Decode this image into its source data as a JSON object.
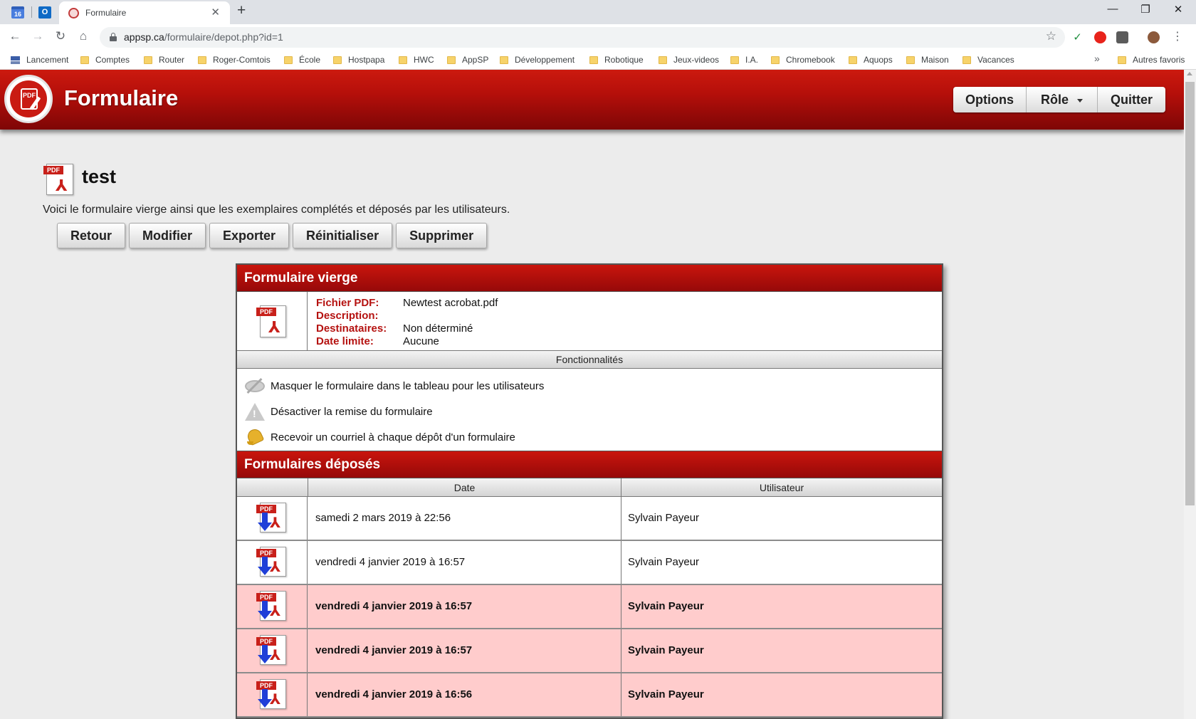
{
  "browser": {
    "pinned_tabs": [
      {
        "name": "calendar",
        "badge": "16"
      },
      {
        "name": "outlook",
        "badge": "O"
      }
    ],
    "active_tab": {
      "title": "Formulaire"
    },
    "url": {
      "host": "appsp.ca",
      "path": "/formulaire/depot.php?id=1"
    },
    "bookmarks": [
      {
        "label": "Lancement",
        "icon": "apps-icon"
      },
      {
        "label": "Comptes",
        "icon": "folder-icon"
      },
      {
        "label": "Router",
        "icon": "folder-icon"
      },
      {
        "label": "Roger-Comtois",
        "icon": "folder-icon"
      },
      {
        "label": "École",
        "icon": "folder-icon"
      },
      {
        "label": "Hostpapa",
        "icon": "folder-icon"
      },
      {
        "label": "HWC",
        "icon": "folder-icon"
      },
      {
        "label": "AppSP",
        "icon": "folder-icon"
      },
      {
        "label": "Développement",
        "icon": "folder-icon"
      },
      {
        "label": "Robotique",
        "icon": "folder-icon"
      },
      {
        "label": "Jeux-videos",
        "icon": "folder-icon"
      },
      {
        "label": "I.A.",
        "icon": "folder-icon"
      },
      {
        "label": "Chromebook",
        "icon": "folder-icon"
      },
      {
        "label": "Aquops",
        "icon": "folder-icon"
      },
      {
        "label": "Maison",
        "icon": "folder-icon"
      },
      {
        "label": "Vacances",
        "icon": "folder-icon"
      }
    ],
    "bookmarks_more": "»",
    "other_bookmarks": "Autres favoris"
  },
  "app": {
    "title": "Formulaire",
    "menu": {
      "options": "Options",
      "role": "Rôle",
      "quit": "Quitter"
    }
  },
  "form": {
    "name": "test",
    "intro": "Voici le formulaire vierge ainsi que les exemplaires complétés et déposés par les utilisateurs.",
    "actions": {
      "back": "Retour",
      "edit": "Modifier",
      "export": "Exporter",
      "reset": "Réinitialiser",
      "delete": "Supprimer"
    }
  },
  "blank_form": {
    "heading": "Formulaire vierge",
    "pdf_label": "PDF",
    "fields": {
      "file_label": "Fichier PDF:",
      "file_value": "Newtest acrobat.pdf",
      "desc_label": "Description:",
      "desc_value": "",
      "recip_label": "Destinataires:",
      "recip_value": "Non déterminé",
      "deadline_label": "Date limite:",
      "deadline_value": "Aucune"
    },
    "features_heading": "Fonctionnalités",
    "features": [
      {
        "label": "Masquer le formulaire dans le tableau pour les utilisateurs",
        "icon": "hidden-eye-icon"
      },
      {
        "label": "Désactiver la remise du formulaire",
        "icon": "warning-icon"
      },
      {
        "label": "Recevoir un courriel à chaque dépôt d'un formulaire",
        "icon": "bell-icon"
      }
    ]
  },
  "submissions": {
    "heading": "Formulaires déposés",
    "columns": {
      "date": "Date",
      "user": "Utilisateur"
    },
    "rows": [
      {
        "date": "samedi 2 mars 2019 à 22:56",
        "user": "Sylvain Payeur",
        "highlighted": false
      },
      {
        "date": "vendredi 4 janvier 2019 à 16:57",
        "user": "Sylvain Payeur",
        "highlighted": false
      },
      {
        "date": "vendredi 4 janvier 2019 à 16:57",
        "user": "Sylvain Payeur",
        "highlighted": true
      },
      {
        "date": "vendredi 4 janvier 2019 à 16:57",
        "user": "Sylvain Payeur",
        "highlighted": true
      },
      {
        "date": "vendredi 4 janvier 2019 à 16:56",
        "user": "Sylvain Payeur",
        "highlighted": true
      }
    ]
  },
  "colors": {
    "brand_red": "#b50f0a",
    "label_red": "#b51210",
    "highlight_row": "#ffcccc"
  }
}
